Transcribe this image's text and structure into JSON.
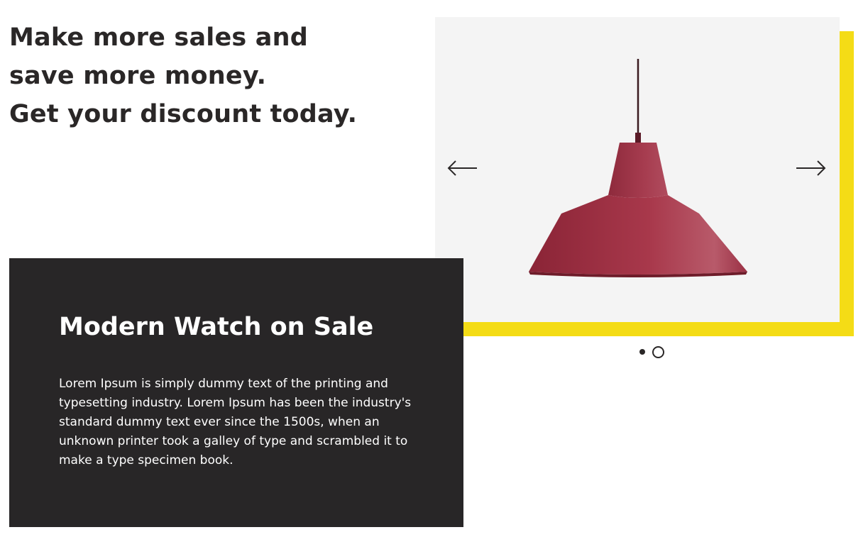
{
  "hero": {
    "headline_lines": [
      "Make more sales and",
      "save more money.",
      "Get your discount today."
    ]
  },
  "promo_card": {
    "title": "Modern Watch on Sale",
    "body": "Lorem Ipsum is simply dummy text of the printing and typesetting industry. Lorem Ipsum has been the industry's standard dummy text ever since the 1500s, when an unknown printer took a galley of type and scrambled it to make a type specimen book."
  },
  "carousel": {
    "slide_count": 2,
    "active_index": 0,
    "prev_icon": "arrow-left-icon",
    "next_icon": "arrow-right-icon",
    "slide_image": "pendant-lamp-image"
  },
  "colors": {
    "dark": "#282627",
    "accent_yellow": "#f4dc16",
    "slide_bg": "#f4f4f4",
    "lamp_red": "#a33a4d"
  }
}
